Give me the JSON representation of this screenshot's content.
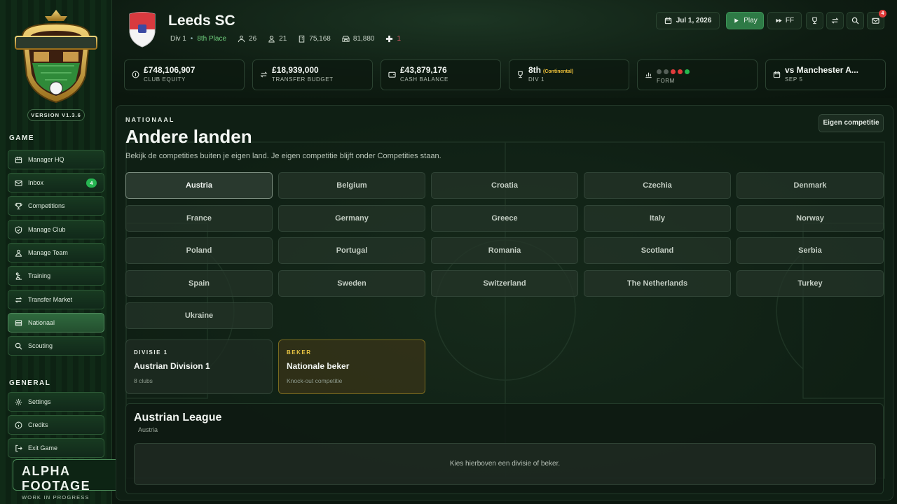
{
  "sidebar": {
    "version": "VERSION V1.3.6",
    "game_title": "GAME",
    "game_items": [
      {
        "label": "Manager HQ"
      },
      {
        "label": "Inbox",
        "badge": "4"
      },
      {
        "label": "Competitions"
      },
      {
        "label": "Manage Club"
      },
      {
        "label": "Manage Team"
      },
      {
        "label": "Training"
      },
      {
        "label": "Transfer Market"
      },
      {
        "label": "Nationaal"
      },
      {
        "label": "Scouting"
      }
    ],
    "general_title": "GENERAL",
    "general_items": [
      {
        "label": "Settings"
      },
      {
        "label": "Credits"
      },
      {
        "label": "Exit Game"
      }
    ],
    "alpha_title": "ALPHA FOOTAGE",
    "alpha_sub": "WORK IN PROGRESS"
  },
  "club": {
    "name": "Leeds SC",
    "division": "Div 1",
    "place": "8th Place",
    "stat1": "26",
    "stat2": "21",
    "stat3": "75,168",
    "stat4": "81,880",
    "plus_value": "1"
  },
  "topbar": {
    "date": "Jul 1, 2026",
    "play_label": "Play",
    "ff_label": "FF",
    "notification_count": "4"
  },
  "cards": {
    "equity": {
      "value": "£748,106,907",
      "label": "CLUB EQUITY"
    },
    "transfer": {
      "value": "£18,939,000",
      "label": "TRANSFER BUDGET"
    },
    "cash": {
      "value": "£43,879,176",
      "label": "CASH BALANCE"
    },
    "position": {
      "value": "8th",
      "tag": "(Continental)",
      "label": "DIV 1"
    },
    "form": {
      "label": "FORM",
      "results": [
        "#555f58",
        "#555f58",
        "#e03c3c",
        "#e03c3c",
        "#25b84f"
      ]
    },
    "next": {
      "value": "vs Manchester A...",
      "label": "SEP 5"
    }
  },
  "main": {
    "kicker": "NATIONAAL",
    "title": "Andere landen",
    "subtitle": "Bekijk de competities buiten je eigen land. Je eigen competitie blijft onder Competities staan.",
    "own_button": "Eigen competitie",
    "countries": [
      "Austria",
      "Belgium",
      "Croatia",
      "Czechia",
      "Denmark",
      "France",
      "Germany",
      "Greece",
      "Italy",
      "Norway",
      "Poland",
      "Portugal",
      "Romania",
      "Scotland",
      "Serbia",
      "Spain",
      "Sweden",
      "Switzerland",
      "The Netherlands",
      "Turkey",
      "Ukraine"
    ],
    "competitions": [
      {
        "kicker": "DIVISIE 1",
        "name": "Austrian Division 1",
        "detail": "8 clubs"
      },
      {
        "kicker": "BEKER",
        "name": "Nationale beker",
        "detail": "Knock-out competitie"
      }
    ],
    "league": {
      "title": "Austrian League",
      "subtitle": "Austria",
      "empty": "Kies hierboven een divisie of beker."
    }
  }
}
